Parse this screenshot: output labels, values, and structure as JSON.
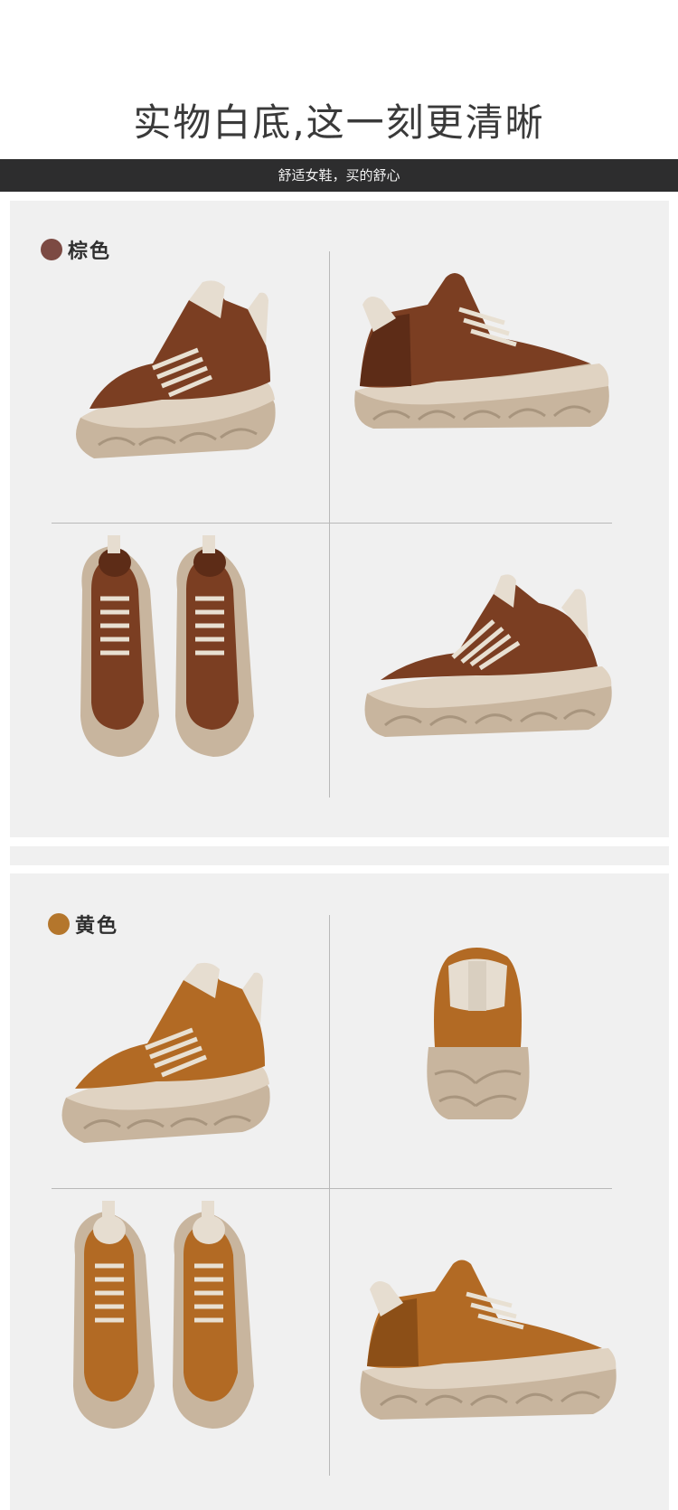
{
  "headline": "实物白底,这一刻更清晰",
  "banner": "舒适女鞋，买的舒心",
  "sections": [
    {
      "label": "棕色",
      "dot_color": "#7c4a43",
      "upper_color": "#7b3e22",
      "upper_dark": "#5d2c17"
    },
    {
      "label": "黄色",
      "dot_color": "#b4762c",
      "upper_color": "#b26a24",
      "upper_dark": "#8c4f17"
    }
  ],
  "colors": {
    "sole": "#c8b59e",
    "sole_dark": "#a8957e",
    "trim": "#e6ddd0",
    "lace": "#e8e0d2"
  }
}
